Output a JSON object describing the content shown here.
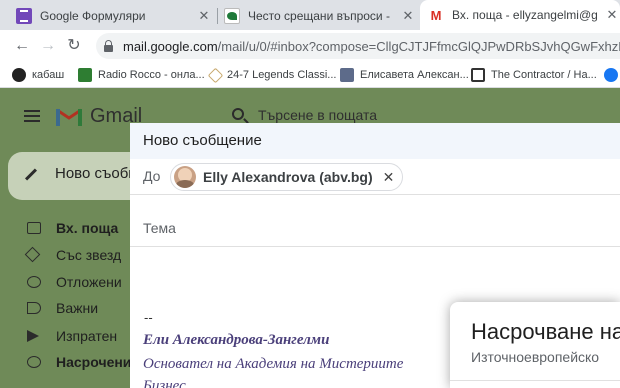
{
  "browser": {
    "tabs": [
      {
        "title": "Google Формуляри",
        "icon": "google-forms-icon"
      },
      {
        "title": "Често срещани въпроси - Блог",
        "icon": "blog-icon"
      },
      {
        "title": "Вх. поща - ellyzangelmi@gmail.c",
        "icon": "gmail-icon"
      }
    ],
    "url_host": "mail.google.com",
    "url_path": "/mail/u/0/#inbox?compose=CllgCJTJFfmcGlQJPwDRbSJvhQGwFxhzDbWKsLg",
    "bookmarks": [
      {
        "label": "кабаш",
        "icon": "kabash-icon"
      },
      {
        "label": "Radio Rocco - онла...",
        "icon": "radio-icon"
      },
      {
        "label": "24-7 Legends Classi...",
        "icon": "legends-icon"
      },
      {
        "label": "Елисавета Алексан...",
        "icon": "profile-icon"
      },
      {
        "label": "The Contractor / Ha...",
        "icon": "contractor-icon"
      }
    ]
  },
  "gmail": {
    "logo_text": "Gmail",
    "search_placeholder": "Търсене в пощата",
    "compose_label": "Ново съобщ",
    "nav": [
      {
        "label": "Вх. поща",
        "bold": true,
        "icon": "inbox-icon"
      },
      {
        "label": "Със звезд",
        "bold": false,
        "icon": "star-icon"
      },
      {
        "label": "Отложени",
        "bold": false,
        "icon": "clock-icon"
      },
      {
        "label": "Важни",
        "bold": false,
        "icon": "label-important-icon"
      },
      {
        "label": "Изпратен",
        "bold": false,
        "icon": "send-icon"
      },
      {
        "label": "Насрочени",
        "bold": true,
        "icon": "scheduled-icon"
      }
    ]
  },
  "compose": {
    "title": "Ново съобщение",
    "to_label": "До",
    "recipient": "Elly Alexandrova (abv.bg)",
    "remove_glyph": "✕",
    "subject_placeholder": "Тема",
    "signature": {
      "dash": "--",
      "name": "Ели Александрова-Зангелми",
      "title": "Основател на Академия на Мистериите",
      "extra": "Бизнес"
    }
  },
  "schedule_dialog": {
    "title": "Насрочване на",
    "timezone": "Източноевропейско"
  }
}
